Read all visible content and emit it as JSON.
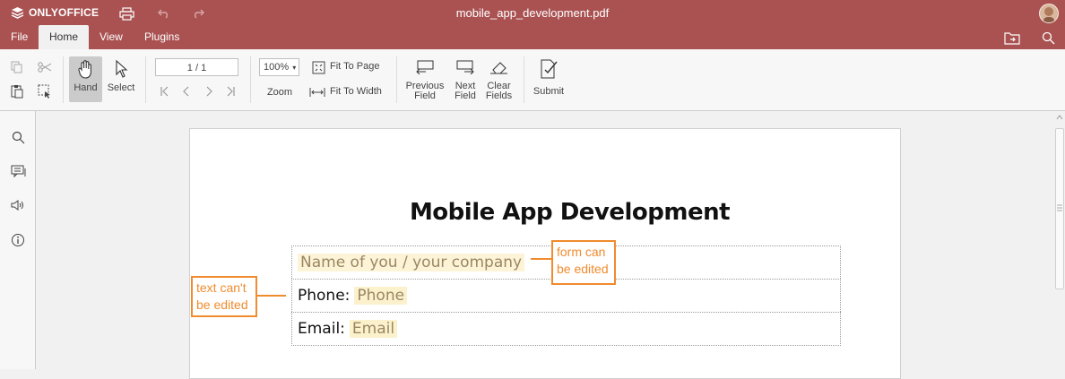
{
  "app": {
    "brand": "ONLYOFFICE",
    "file_name": "mobile_app_development.pdf"
  },
  "menu": {
    "tabs": [
      "File",
      "Home",
      "View",
      "Plugins"
    ],
    "active": "Home"
  },
  "toolbar": {
    "hand_label": "Hand",
    "select_label": "Select",
    "page_value": "1 / 1",
    "zoom_value": "100%",
    "zoom_label": "Zoom",
    "fit_page_label": "Fit To Page",
    "fit_width_label": "Fit To Width",
    "previous_field": [
      "Previous",
      "Field"
    ],
    "next_field": [
      "Next",
      "Field"
    ],
    "clear_fields": [
      "Clear",
      "Fields"
    ],
    "submit_label": "Submit"
  },
  "document": {
    "heading": "Mobile App Development",
    "name_field": "Name of you / your company",
    "phone_label": "Phone:",
    "phone_field": "Phone",
    "email_label": "Email:",
    "email_field": "Email"
  },
  "annotations": {
    "form_can_be_edited": [
      "form can",
      "be edited"
    ],
    "text_cant_be_edited": [
      "text can't",
      "be edited"
    ]
  },
  "colors": {
    "titlebar": "#aa5252",
    "callout": "#f08b2e",
    "field_bg": "#fcf1cd"
  }
}
